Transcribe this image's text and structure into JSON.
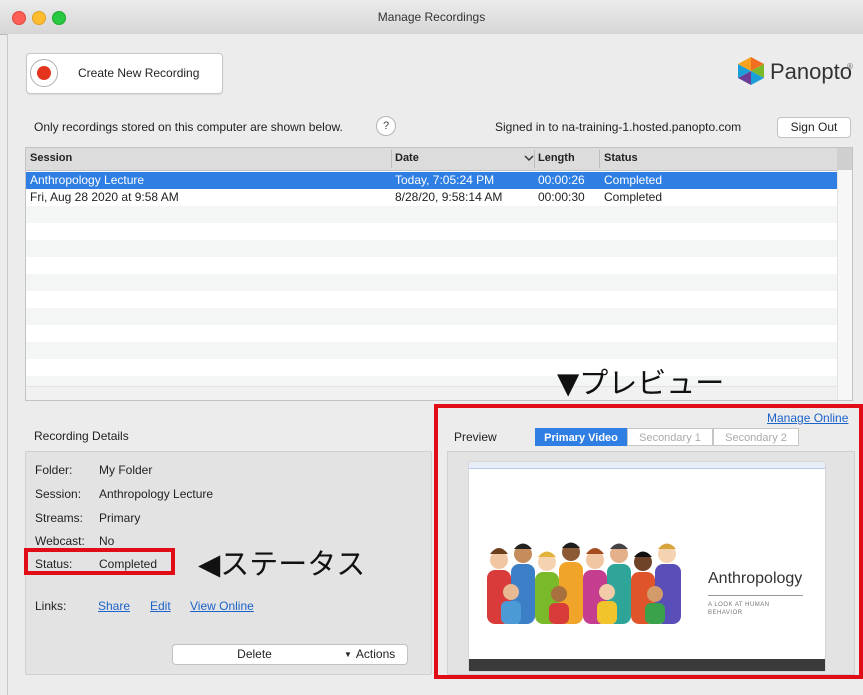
{
  "window": {
    "title": "Manage Recordings"
  },
  "toolbar": {
    "new_recording_label": "Create New Recording"
  },
  "brand": {
    "name": "Panopto",
    "trademark": "®",
    "colors": [
      "#f26f22",
      "#7ab929",
      "#1a9fd9",
      "#6c3c96"
    ]
  },
  "info": {
    "notice": "Only recordings stored on this computer are shown below.",
    "help": "?",
    "signed_in": "Signed in to na-training-1.hosted.panopto.com",
    "sign_out": "Sign Out"
  },
  "table": {
    "columns": {
      "session": "Session",
      "date": "Date",
      "length": "Length",
      "status": "Status"
    },
    "rows": [
      {
        "session": "Anthropology Lecture",
        "date": "Today, 7:05:24 PM",
        "length": "00:00:26",
        "status": "Completed",
        "selected": true
      },
      {
        "session": "Fri, Aug 28 2020 at 9:58 AM",
        "date": "8/28/20, 9:58:14 AM",
        "length": "00:00:30",
        "status": "Completed",
        "selected": false
      }
    ],
    "selection_color": "#2f7ee3"
  },
  "details": {
    "title": "Recording Details",
    "folder_label": "Folder:",
    "folder_value": "My Folder",
    "session_label": "Session:",
    "session_value": "Anthropology Lecture",
    "streams_label": "Streams:",
    "streams_value": "Primary",
    "webcast_label": "Webcast:",
    "webcast_value": "No",
    "status_label": "Status:",
    "status_value": "Completed",
    "links_label": "Links:",
    "links": {
      "share": "Share",
      "edit": "Edit",
      "view_online": "View Online"
    },
    "delete": "Delete",
    "actions": "Actions"
  },
  "preview": {
    "label": "Preview",
    "manage_online": "Manage Online",
    "tabs": {
      "primary": "Primary Video",
      "secondary1": "Secondary 1",
      "secondary2": "Secondary 2"
    },
    "slide_title": "Anthropology",
    "slide_subtitle": "A LOOK AT HUMAN BEHAVIOR"
  },
  "annotations": {
    "status_note": "◀ステータス",
    "preview_note": "▼プレビュー",
    "highlight_color": "#e00c16"
  }
}
